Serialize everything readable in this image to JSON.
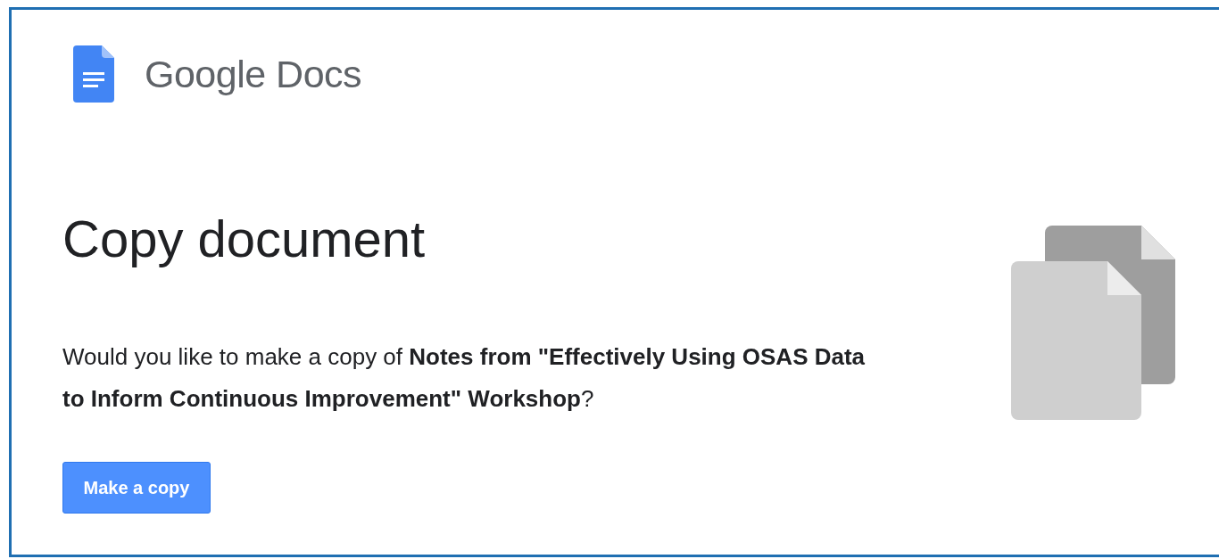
{
  "header": {
    "product_name": "Google Docs"
  },
  "title": "Copy document",
  "message": "Would you like to make a copy of **Notes from \"Effectively Using OSAS Data to Inform Continuous Improvement\" Workshop**?",
  "button": {
    "label": "Make a copy"
  }
}
